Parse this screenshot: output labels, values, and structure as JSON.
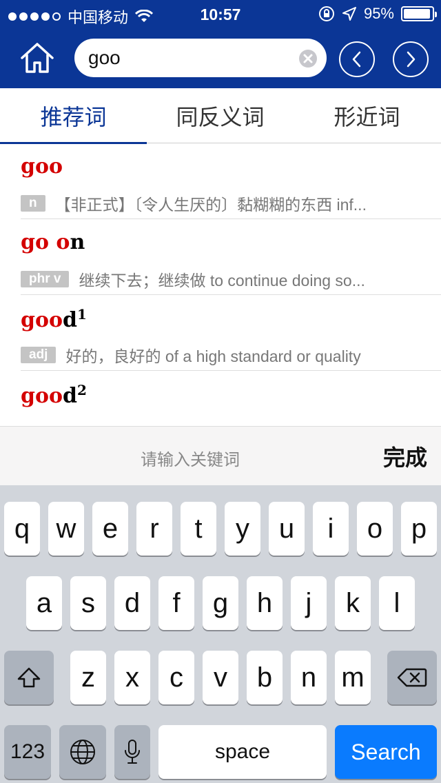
{
  "status_bar": {
    "carrier": "中国移动",
    "time": "10:57",
    "battery": "95%",
    "battery_level": 0.95
  },
  "search": {
    "value": "goo"
  },
  "tabs": [
    {
      "label": "推荐词",
      "active": true
    },
    {
      "label": "同反义词",
      "active": false
    },
    {
      "label": "形近词",
      "active": false
    }
  ],
  "results": [
    {
      "highlight": "goo",
      "rest": "",
      "sup": "",
      "pos": "n",
      "definition": "【非正式】〔令人生厌的〕黏糊糊的东西 inf..."
    },
    {
      "highlight": "go o",
      "rest": "n",
      "sup": "",
      "pos": "phr v",
      "definition": "继续下去；继续做 to continue doing so..."
    },
    {
      "highlight": "goo",
      "rest": "d",
      "sup": "1",
      "pos": "adj",
      "definition": "好的，良好的 of a high standard or quality"
    },
    {
      "highlight": "goo",
      "rest": "d",
      "sup": "2",
      "pos": "",
      "definition": ""
    }
  ],
  "keyboard_toolbar": {
    "hint": "请输入关键词",
    "done": "完成"
  },
  "keyboard": {
    "row1": [
      "q",
      "w",
      "e",
      "r",
      "t",
      "y",
      "u",
      "i",
      "o",
      "p"
    ],
    "row2": [
      "a",
      "s",
      "d",
      "f",
      "g",
      "h",
      "j",
      "k",
      "l"
    ],
    "row3": [
      "z",
      "x",
      "c",
      "v",
      "b",
      "n",
      "m"
    ],
    "numbers_key": "123",
    "space_key": "space",
    "search_key": "Search"
  },
  "colors": {
    "header_bg": "#0b3696",
    "highlight": "#d40000",
    "search_key": "#0a7bfe"
  },
  "icons": {
    "home": "home-icon",
    "clear": "clear-icon",
    "back": "chevron-left-icon",
    "forward": "chevron-right-icon",
    "shift": "shift-icon",
    "delete": "backspace-icon",
    "globe": "globe-icon",
    "mic": "microphone-icon"
  }
}
